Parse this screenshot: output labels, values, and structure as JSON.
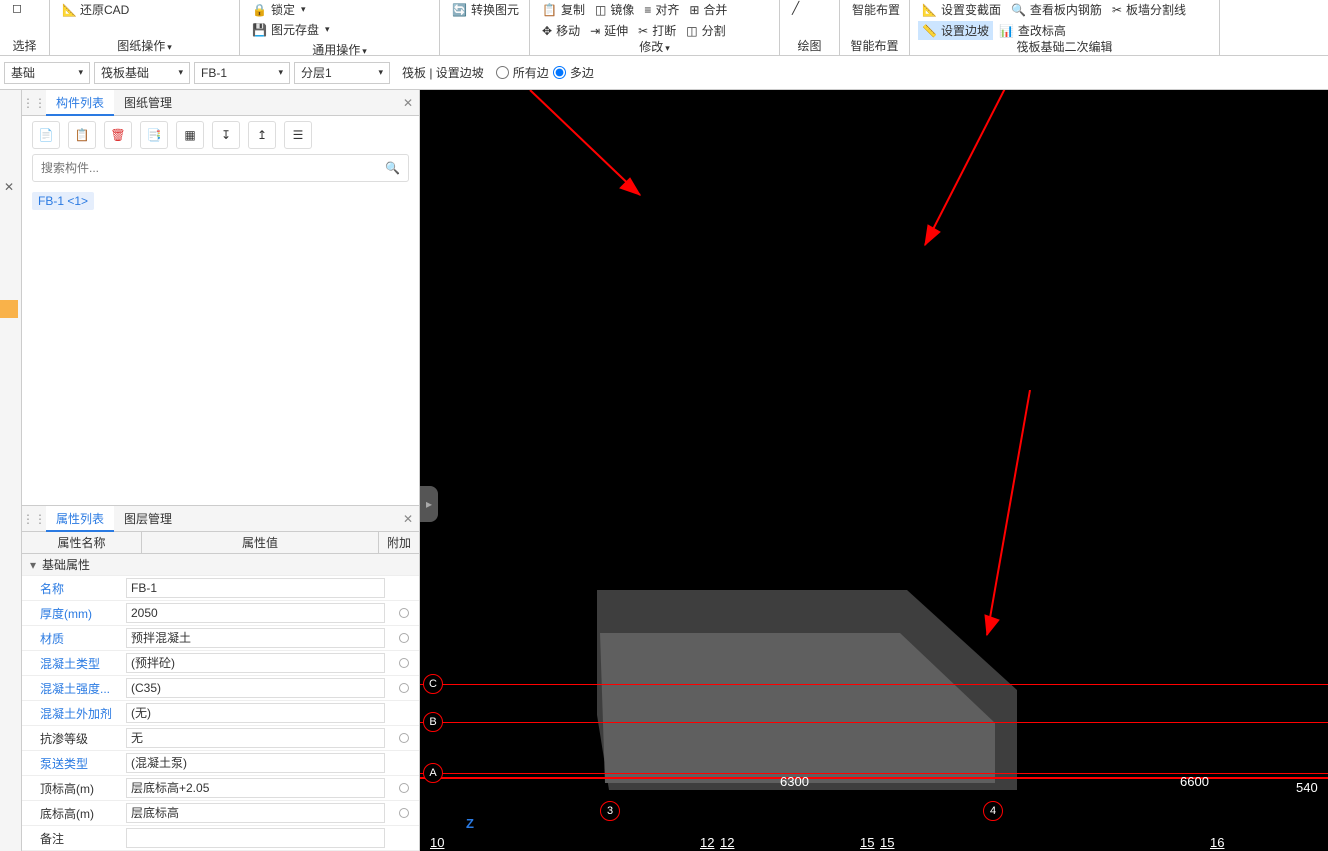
{
  "ribbon": {
    "g0": {
      "sel": "选择",
      "restoreCad": "还原CAD"
    },
    "g1": {
      "label": "图纸操作"
    },
    "g2": {
      "label": "通用操作",
      "lock": "锁定",
      "storage": "图元存盘",
      "convert": "转换图元"
    },
    "g3": {
      "label": "修改",
      "copy": "复制",
      "move": "移动",
      "mirror": "镜像",
      "extend": "延伸",
      "align": "对齐",
      "break": "打断",
      "merge": "合并",
      "split": "分割"
    },
    "g4": {
      "label": "绘图"
    },
    "g5": {
      "label": "智能布置",
      "smart": "智能布置"
    },
    "g6": {
      "label": "筏板基础二次编辑",
      "setSection": "设置变截面",
      "seeRebar": "查看板内钢筋",
      "setSlope": "设置边坡",
      "chkElev": "查改标高",
      "boardSplit": "板墙分割线"
    }
  },
  "subbar": {
    "c0": "基础",
    "c1": "筏板基础",
    "c2": "FB-1",
    "c3": "分层1",
    "mode": "筏板 | 设置边坡",
    "opt1": "所有边",
    "opt2": "多边"
  },
  "tabs": {
    "components": "构件列表",
    "drawings": "图纸管理"
  },
  "search": {
    "placeholder": "搜索构件..."
  },
  "list": {
    "item0": "FB-1 <1>"
  },
  "propTabs": {
    "props": "属性列表",
    "layers": "图层管理"
  },
  "propHeader": {
    "name": "属性名称",
    "value": "属性值",
    "addon": "附加"
  },
  "propSection": "基础属性",
  "props": [
    {
      "n": "名称",
      "v": "FB-1",
      "link": true,
      "addon": false
    },
    {
      "n": "厚度(mm)",
      "v": "2050",
      "link": true,
      "addon": true
    },
    {
      "n": "材质",
      "v": "预拌混凝土",
      "link": true,
      "addon": true
    },
    {
      "n": "混凝土类型",
      "v": "(预拌砼)",
      "link": true,
      "addon": true
    },
    {
      "n": "混凝土强度...",
      "v": "(C35)",
      "link": true,
      "addon": true
    },
    {
      "n": "混凝土外加剂",
      "v": "(无)",
      "link": true,
      "addon": false
    },
    {
      "n": "抗渗等级",
      "v": "无",
      "link": false,
      "addon": true
    },
    {
      "n": "泵送类型",
      "v": "(混凝土泵)",
      "link": true,
      "addon": false
    },
    {
      "n": "顶标高(m)",
      "v": "层底标高+2.05",
      "link": false,
      "addon": true
    },
    {
      "n": "底标高(m)",
      "v": "层底标高",
      "link": false,
      "addon": true
    },
    {
      "n": "备注",
      "v": "",
      "link": false,
      "addon": false
    }
  ],
  "vp": {
    "axC": "C",
    "axB": "B",
    "axA": "A",
    "ax3": "3",
    "ax4": "4",
    "dim63": "6300",
    "dim66": "6600",
    "dim540": "540",
    "rulerVals": [
      "10",
      "12",
      "12",
      "15",
      "15",
      "16"
    ]
  }
}
